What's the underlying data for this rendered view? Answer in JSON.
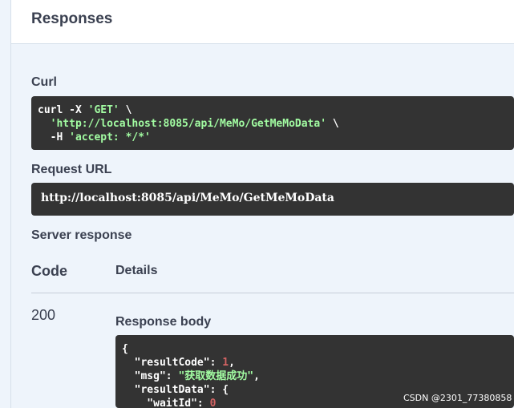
{
  "section": {
    "title": "Responses"
  },
  "curl": {
    "label": "Curl",
    "line1_prefix": "curl -X ",
    "line1_method": "'GET'",
    "line1_suffix": " \\",
    "line2_prefix": "  ",
    "line2_url": "'http://localhost:8085/api/MeMo/GetMeMoData'",
    "line2_suffix": " \\",
    "line3_prefix": "  -H ",
    "line3_header": "'accept: */*'"
  },
  "request_url": {
    "label": "Request URL",
    "value": "http://localhost:8085/api/MeMo/GetMeMoData"
  },
  "server_response": {
    "label": "Server response",
    "col_code": "Code",
    "col_details": "Details",
    "status_code": "200",
    "body_label": "Response body",
    "body": {
      "l1": "{",
      "l2_key": "  \"resultCode\"",
      "l2_sep": ": ",
      "l2_val": "1",
      "l2_end": ",",
      "l3_key": "  \"msg\"",
      "l3_sep": ": ",
      "l3_val": "\"获取数据成功\"",
      "l3_end": ",",
      "l4_key": "  \"resultData\"",
      "l4_sep": ": {",
      "l5_key": "    \"waitId\"",
      "l5_sep": ": ",
      "l5_val": "0"
    }
  },
  "watermark": "CSDN @2301_77380858"
}
